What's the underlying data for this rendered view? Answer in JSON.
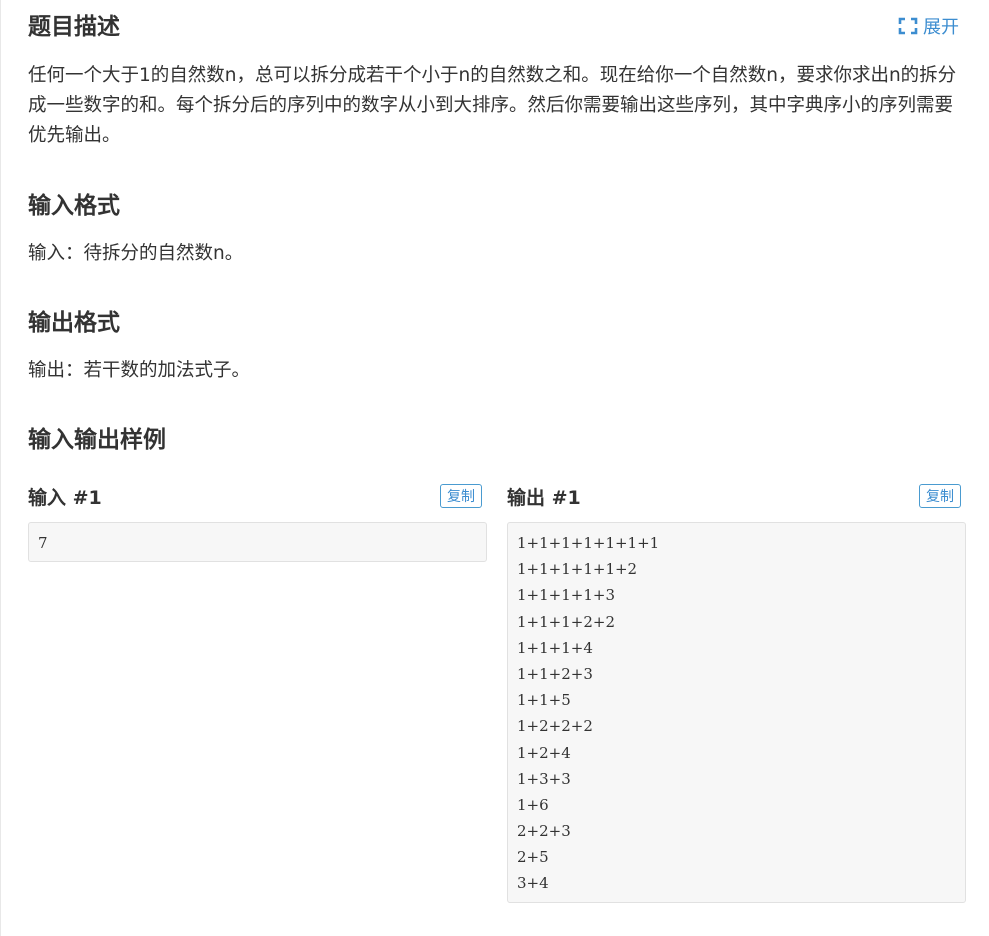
{
  "description": {
    "title": "题目描述",
    "expand_label": "展开",
    "text": "任何一个大于1的自然数n，总可以拆分成若干个小于n的自然数之和。现在给你一个自然数n，要求你求出n的拆分成一些数字的和。每个拆分后的序列中的数字从小到大排序。然后你需要输出这些序列，其中字典序小的序列需要优先输出。"
  },
  "input_format": {
    "title": "输入格式",
    "text": "输入：待拆分的自然数n。"
  },
  "output_format": {
    "title": "输出格式",
    "text": "输出：若干数的加法式子。"
  },
  "samples": {
    "title": "输入输出样例",
    "input": {
      "label": "输入 #1",
      "copy_label": "复制",
      "lines": [
        "7"
      ]
    },
    "output": {
      "label": "输出 #1",
      "copy_label": "复制",
      "lines": [
        "1+1+1+1+1+1+1",
        "1+1+1+1+1+2",
        "1+1+1+1+3",
        "1+1+1+2+2",
        "1+1+1+4",
        "1+1+2+3",
        "1+1+5",
        "1+2+2+2",
        "1+2+4",
        "1+3+3",
        "1+6",
        "2+2+3",
        "2+5",
        "3+4"
      ]
    }
  },
  "colors": {
    "accent": "#3c8dd0",
    "text": "#333333",
    "code_bg": "#f7f7f7"
  }
}
